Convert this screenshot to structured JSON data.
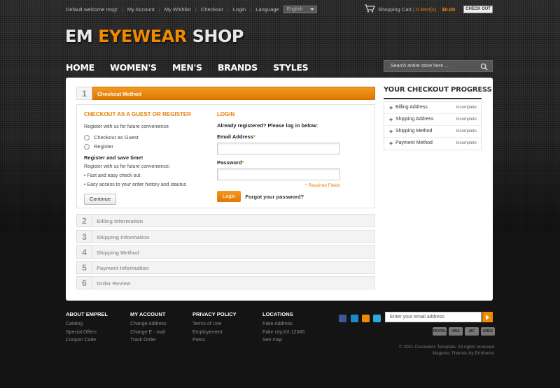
{
  "topbar": {
    "welcome": "Default welcome msg!",
    "links": [
      "My Account",
      "My Wishlist",
      "Checkout",
      "Login"
    ],
    "language_label": "Language",
    "language_value": "English",
    "cart_label": "Shopping Cart",
    "cart_items": "0 item(s)",
    "cart_total": "$0.00",
    "checkout_button": "CHECK OUT"
  },
  "logo": {
    "part1": "EM",
    "part2": "EYEWEAR",
    "part3": "SHOP"
  },
  "nav": {
    "items": [
      "HOME",
      "WOMEN'S",
      "MEN'S",
      "BRANDS",
      "STYLES"
    ]
  },
  "search": {
    "placeholder": "Search entire store here ..."
  },
  "checkout": {
    "active_step": {
      "number": "1",
      "title": "Checkout Method"
    },
    "guest": {
      "title": "CHECKOUT AS A GUEST OR REGISTER",
      "intro": "Register with us for future convenience",
      "options": [
        "Checkout as Guest",
        "Register"
      ],
      "save_title": "Register and save time!",
      "save_intro": "Register with us for future convenience:",
      "benefits": [
        "Fast and easy check out",
        "Easy access to your order history and stautus"
      ],
      "continue_button": "Continue"
    },
    "login": {
      "title": "LOGIN",
      "intro": "Already registered? Please log in below:",
      "email_label": "Email Address",
      "password_label": "Password",
      "required_mark": "*",
      "required_note": "* Required Fields",
      "login_button": "Login",
      "forgot_link": "Forgot your password?"
    },
    "steps": [
      {
        "number": "2",
        "title": "Billing Information"
      },
      {
        "number": "3",
        "title": "Shipping Information"
      },
      {
        "number": "4",
        "title": "Shipping Method"
      },
      {
        "number": "5",
        "title": "Payment Information"
      },
      {
        "number": "6",
        "title": "Order Review"
      }
    ]
  },
  "progress": {
    "title": "YOUR CHECKOUT PROGRESS",
    "items": [
      {
        "label": "Billing Address",
        "status": "Incomplete"
      },
      {
        "label": "Shipping Address",
        "status": "Incomplete"
      },
      {
        "label": "Shipping Method",
        "status": "Incomplete"
      },
      {
        "label": "Payment Method",
        "status": "Incomplete"
      }
    ]
  },
  "footer": {
    "columns": [
      {
        "title": "ABOUT EMPREL",
        "links": [
          "Catalog",
          "Special Offers",
          "Coupon Code"
        ]
      },
      {
        "title": "MY ACCOUNT",
        "links": [
          "Change Address",
          "Change E - mail",
          "Track Order"
        ]
      },
      {
        "title": "PRIVACY POLICY",
        "links": [
          "Terms of Use",
          "Employement",
          "Press"
        ]
      },
      {
        "title": "LOCATIONS",
        "links": [
          "Fake Address",
          "Fake city,XX 12345",
          "See map"
        ]
      }
    ],
    "newsletter_placeholder": "Enter your email address",
    "payment_icons": [
      "PAYPAL",
      "VISA",
      "MC",
      "AMEX"
    ],
    "copyright_line1": "© 2011  Cosmetics Template. All rights reserved",
    "copyright_line2": "Magento Themes by Emthems"
  },
  "colors": {
    "accent": "#f08a00",
    "background": "#2b2b2b",
    "panel": "#ffffff"
  }
}
